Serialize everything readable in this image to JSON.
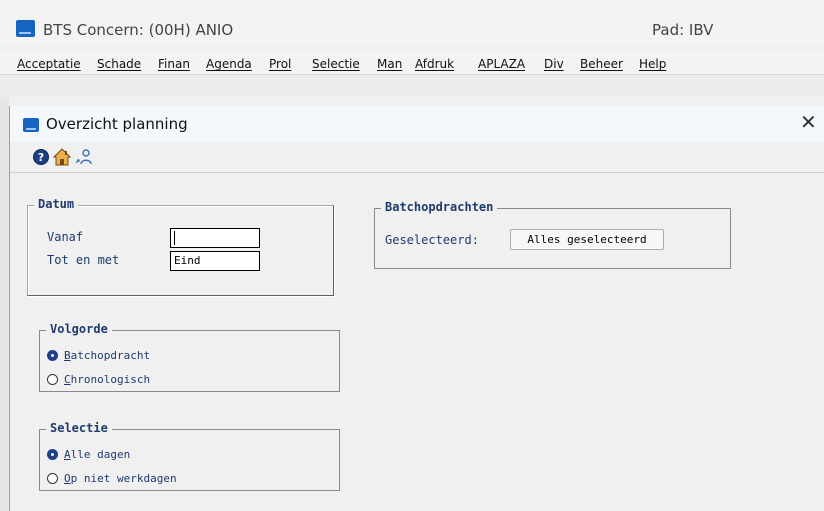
{
  "app": {
    "title": "BTS Concern: (00H) ANIO",
    "pad": "Pad: IBV",
    "brand_color": "#1565c0"
  },
  "menu": [
    {
      "label": "Acceptatie"
    },
    {
      "label": "Schade"
    },
    {
      "label": "Finan"
    },
    {
      "label": "Agenda"
    },
    {
      "label": "Prol"
    },
    {
      "label": "Selectie"
    },
    {
      "label": "Man"
    },
    {
      "label": "Afdruk"
    },
    {
      "label": "APLAZA"
    },
    {
      "label": "Div"
    },
    {
      "label": "Beheer"
    },
    {
      "label": "Help"
    }
  ],
  "window": {
    "title": "Overzicht planning",
    "close_glyph": "✕"
  },
  "toolbar": {
    "icons": [
      "help-icon",
      "home-icon",
      "user-link-icon"
    ]
  },
  "datum": {
    "legend": "Datum",
    "vanaf_label": "Vanaf",
    "vanaf_value": "",
    "totenmet_label": "Tot en met",
    "totenmet_value": "Eind"
  },
  "batch": {
    "legend": "Batchopdrachten",
    "geselecteerd_label": "Geselecteerd:",
    "button_label": "Alles geselecteerd"
  },
  "volgorde": {
    "legend": "Volgorde",
    "options": [
      {
        "access": "B",
        "rest": "atchopdracht",
        "selected": true
      },
      {
        "access": "C",
        "rest": "hronologisch",
        "selected": false
      }
    ]
  },
  "selectie": {
    "legend": "Selectie",
    "options": [
      {
        "access": "A",
        "rest": "lle dagen",
        "selected": true
      },
      {
        "access": "O",
        "rest": "p niet werkdagen",
        "selected": false
      }
    ]
  },
  "colors": {
    "label_blue": "#1f3a6e",
    "radio_selected": "#1e3f86"
  }
}
